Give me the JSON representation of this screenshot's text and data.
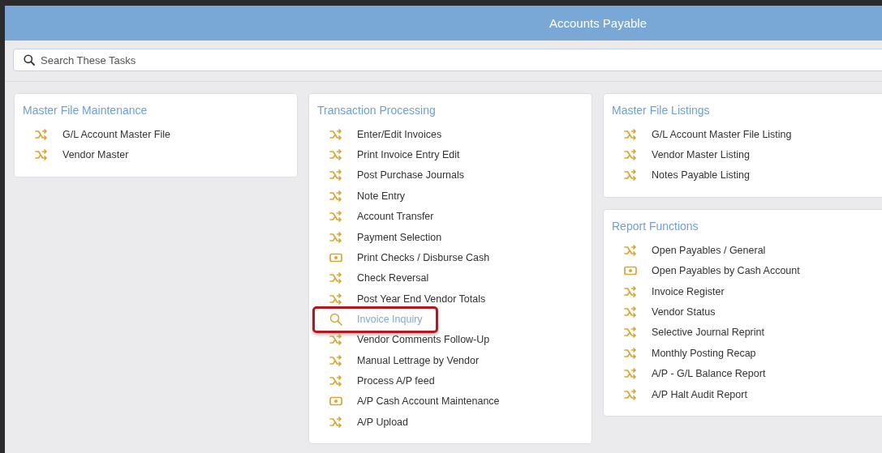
{
  "window": {
    "title": "Accounts Payable"
  },
  "search": {
    "placeholder": "Search These Tasks"
  },
  "columns": [
    {
      "panels": [
        {
          "title": "Master File Maintenance",
          "items": [
            {
              "label": "G/L Account Master File",
              "kind": "shuffle",
              "highlighted": false
            },
            {
              "label": "Vendor Master",
              "kind": "shuffle",
              "highlighted": false
            }
          ]
        }
      ]
    },
    {
      "panels": [
        {
          "title": "Transaction Processing",
          "items": [
            {
              "label": "Enter/Edit Invoices",
              "kind": "shuffle",
              "highlighted": false
            },
            {
              "label": "Print Invoice Entry Edit",
              "kind": "shuffle",
              "highlighted": false
            },
            {
              "label": "Post Purchase Journals",
              "kind": "shuffle",
              "highlighted": false
            },
            {
              "label": "Note Entry",
              "kind": "shuffle",
              "highlighted": false
            },
            {
              "label": "Account Transfer",
              "kind": "shuffle",
              "highlighted": false
            },
            {
              "label": "Payment Selection",
              "kind": "shuffle",
              "highlighted": false
            },
            {
              "label": "Print Checks / Disburse Cash",
              "kind": "cash",
              "highlighted": false
            },
            {
              "label": "Check Reversal",
              "kind": "shuffle",
              "highlighted": false
            },
            {
              "label": "Post Year End Vendor Totals",
              "kind": "shuffle",
              "highlighted": false
            },
            {
              "label": "Invoice Inquiry",
              "kind": "search",
              "highlighted": true
            },
            {
              "label": "Vendor Comments Follow-Up",
              "kind": "shuffle",
              "highlighted": false
            },
            {
              "label": "Manual Lettrage by Vendor",
              "kind": "shuffle",
              "highlighted": false
            },
            {
              "label": "Process A/P feed",
              "kind": "shuffle",
              "highlighted": false
            },
            {
              "label": "A/P Cash Account Maintenance",
              "kind": "cash",
              "highlighted": false
            },
            {
              "label": "A/P Upload",
              "kind": "shuffle",
              "highlighted": false
            }
          ]
        }
      ]
    },
    {
      "panels": [
        {
          "title": "Master File Listings",
          "items": [
            {
              "label": "G/L Account Master File Listing",
              "kind": "shuffle",
              "highlighted": false
            },
            {
              "label": "Vendor Master Listing",
              "kind": "shuffle",
              "highlighted": false
            },
            {
              "label": "Notes Payable Listing",
              "kind": "shuffle",
              "highlighted": false
            }
          ]
        },
        {
          "title": "Report Functions",
          "items": [
            {
              "label": "Open Payables / General",
              "kind": "shuffle",
              "highlighted": false
            },
            {
              "label": "Open Payables by Cash Account",
              "kind": "cash",
              "highlighted": false
            },
            {
              "label": "Invoice Register",
              "kind": "shuffle",
              "highlighted": false
            },
            {
              "label": "Vendor Status",
              "kind": "shuffle",
              "highlighted": false
            },
            {
              "label": "Selective Journal Reprint",
              "kind": "shuffle",
              "highlighted": false
            },
            {
              "label": "Monthly Posting Recap",
              "kind": "shuffle",
              "highlighted": false
            },
            {
              "label": "A/P - G/L Balance Report",
              "kind": "shuffle",
              "highlighted": false
            },
            {
              "label": "A/P Halt Audit Report",
              "kind": "shuffle",
              "highlighted": false
            }
          ]
        }
      ]
    }
  ]
}
